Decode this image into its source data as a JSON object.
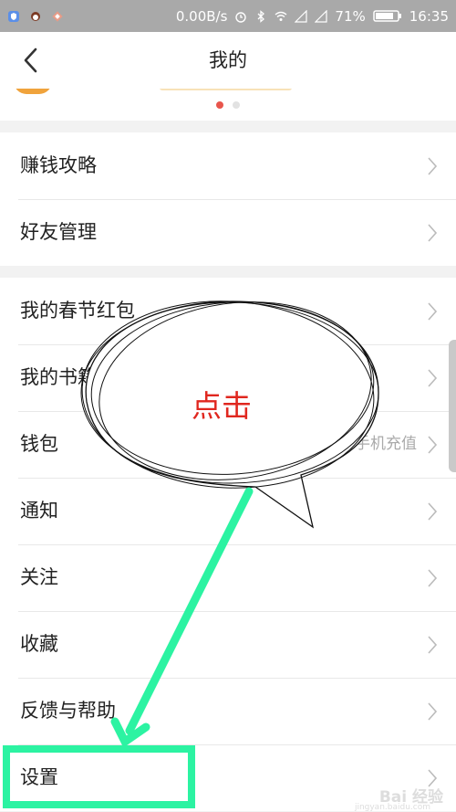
{
  "status_bar": {
    "speed": "0.00B/s",
    "battery": "71%",
    "time": "16:35"
  },
  "header": {
    "title": "我的"
  },
  "carousel": {
    "active_index": 0,
    "count": 2
  },
  "group1": [
    {
      "label": "赚钱攻略"
    },
    {
      "label": "好友管理"
    }
  ],
  "group2": [
    {
      "label": "我的春节红包",
      "hint": ""
    },
    {
      "label": "我的书籍",
      "hint": ""
    },
    {
      "label": "钱包",
      "hint": "手机充值"
    },
    {
      "label": "通知",
      "hint": ""
    },
    {
      "label": "关注",
      "hint": ""
    },
    {
      "label": "收藏",
      "hint": ""
    },
    {
      "label": "反馈与帮助",
      "hint": ""
    },
    {
      "label": "设置",
      "hint": ""
    }
  ],
  "annotation": {
    "callout_text": "点击",
    "arrow_color": "#2cf3a2",
    "callout_text_color": "#e0271f"
  },
  "watermark": {
    "main": "Bai 经验",
    "sub": "jingyan.baidu.com"
  }
}
